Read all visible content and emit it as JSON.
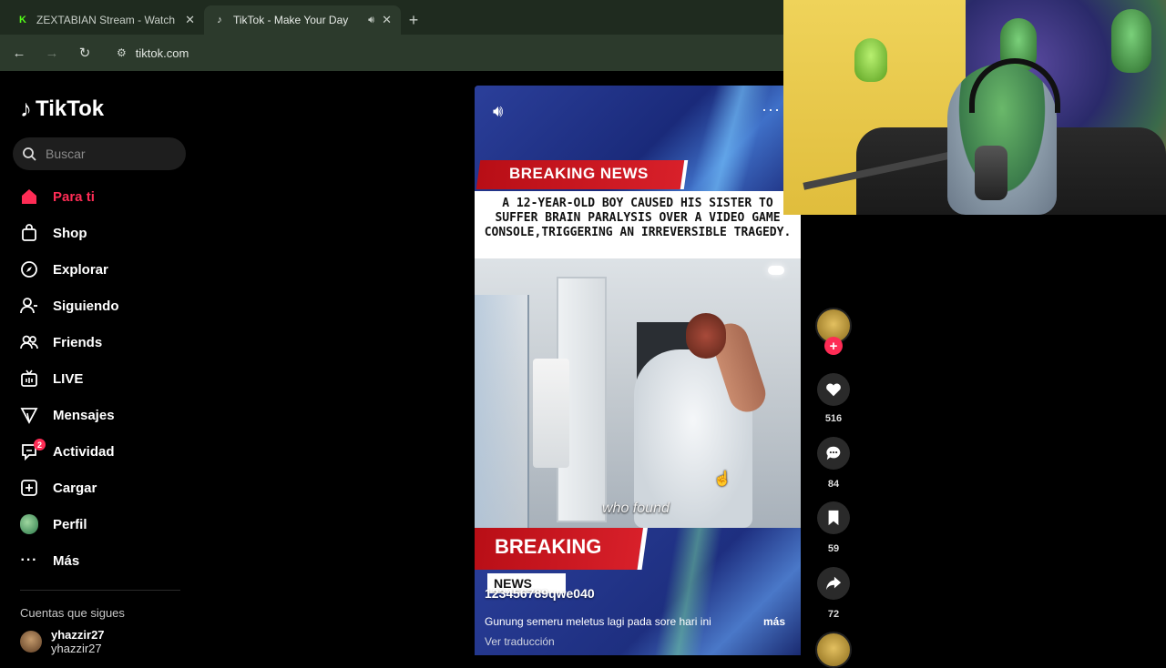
{
  "browser": {
    "tabs": [
      {
        "title": "ZEXTABIAN Stream - Watch Live",
        "favicon": "K",
        "favicon_color": "#53fc18",
        "active": false
      },
      {
        "title": "TikTok - Make Your Day",
        "favicon": "♪",
        "favicon_color": "#ffffff",
        "active": true
      }
    ],
    "url": "tiktok.com"
  },
  "sidebar": {
    "logo": "TikTok",
    "search_placeholder": "Buscar",
    "items": [
      {
        "label": "Para ti",
        "icon": "home-icon",
        "active": true
      },
      {
        "label": "Shop",
        "icon": "shop-icon"
      },
      {
        "label": "Explorar",
        "icon": "compass-icon"
      },
      {
        "label": "Siguiendo",
        "icon": "person-follow-icon"
      },
      {
        "label": "Friends",
        "icon": "friends-icon"
      },
      {
        "label": "LIVE",
        "icon": "live-tv-icon"
      },
      {
        "label": "Mensajes",
        "icon": "paper-plane-icon"
      },
      {
        "label": "Actividad",
        "icon": "inbox-icon",
        "badge": "2"
      },
      {
        "label": "Cargar",
        "icon": "plus-square-icon"
      },
      {
        "label": "Perfil",
        "icon": "avatar"
      },
      {
        "label": "Más",
        "icon": "ellipsis-icon"
      }
    ],
    "following_heading": "Cuentas que sigues",
    "following": [
      {
        "name": "yhazzir27",
        "handle": "yhazzir27"
      }
    ]
  },
  "video": {
    "banner_top": "BREAKING NEWS",
    "headline": "A 12-YEAR-OLD BOY CAUSED HIS SISTER TO SUFFER BRAIN PARALYSIS OVER A VIDEO GAME CONSOLE,TRIGGERING AN IRREVERSIBLE TRAGEDY.",
    "caption": "who found",
    "banner_bottom": "BREAKING",
    "news_chip": "NEWS",
    "author": "123456789qwe040",
    "description": "Gunung semeru meletus lagi pada sore hari ini",
    "more_label": "más",
    "translate_label": "Ver traducción"
  },
  "actions": {
    "likes": "516",
    "comments": "84",
    "saves": "59",
    "shares": "72"
  },
  "colors": {
    "accent": "#fe2c55",
    "browser_bg": "#2c3a2c",
    "page_bg": "#000000"
  }
}
